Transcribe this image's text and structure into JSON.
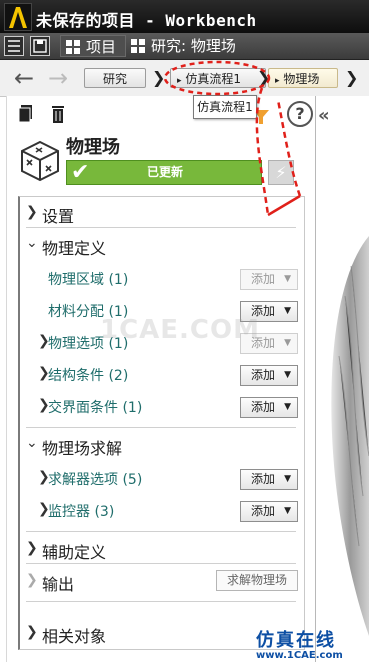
{
  "window": {
    "title": "未保存的项目 - Workbench"
  },
  "tabs": [
    {
      "label": "项目"
    },
    {
      "label": "研究: 物理场"
    }
  ],
  "breadcrumb": {
    "items": [
      "研究",
      "仿真流程1",
      "物理场"
    ],
    "tooltip": "仿真流程1"
  },
  "node": {
    "title": "物理场",
    "status": "已更新",
    "status_color": "#78b83b"
  },
  "tree": {
    "settings": "设置",
    "physics_def": "物理定义",
    "physics_def_items": [
      {
        "label": "物理区域 (1)",
        "button": "添加",
        "enabled": false
      },
      {
        "label": "材料分配 (1)",
        "button": "添加",
        "enabled": true
      },
      {
        "label": "物理选项 (1)",
        "button": "添加",
        "enabled": false
      },
      {
        "label": "结构条件 (2)",
        "button": "添加",
        "enabled": true
      },
      {
        "label": "交界面条件 (1)",
        "button": "添加",
        "enabled": true
      }
    ],
    "solve": "物理场求解",
    "solve_items": [
      {
        "label": "求解器选项 (5)",
        "button": "添加",
        "enabled": true
      },
      {
        "label": "监控器 (3)",
        "button": "添加",
        "enabled": true
      }
    ],
    "aux_def": "辅助定义",
    "output": "输出",
    "solve_button": "求解物理场",
    "related": "相关对象"
  },
  "footer": {
    "logo": "仿真在线",
    "url": "www.1CAE.com"
  },
  "watermark": "1CAE.COM",
  "icons": [
    "app-logo-icon",
    "list-icon",
    "save-icon",
    "back-arrow-icon",
    "forward-arrow-icon",
    "copy-icon",
    "delete-icon",
    "filter-icon",
    "help-icon",
    "collapse-icon",
    "physics-node-icon",
    "check-icon",
    "lightning-icon"
  ]
}
